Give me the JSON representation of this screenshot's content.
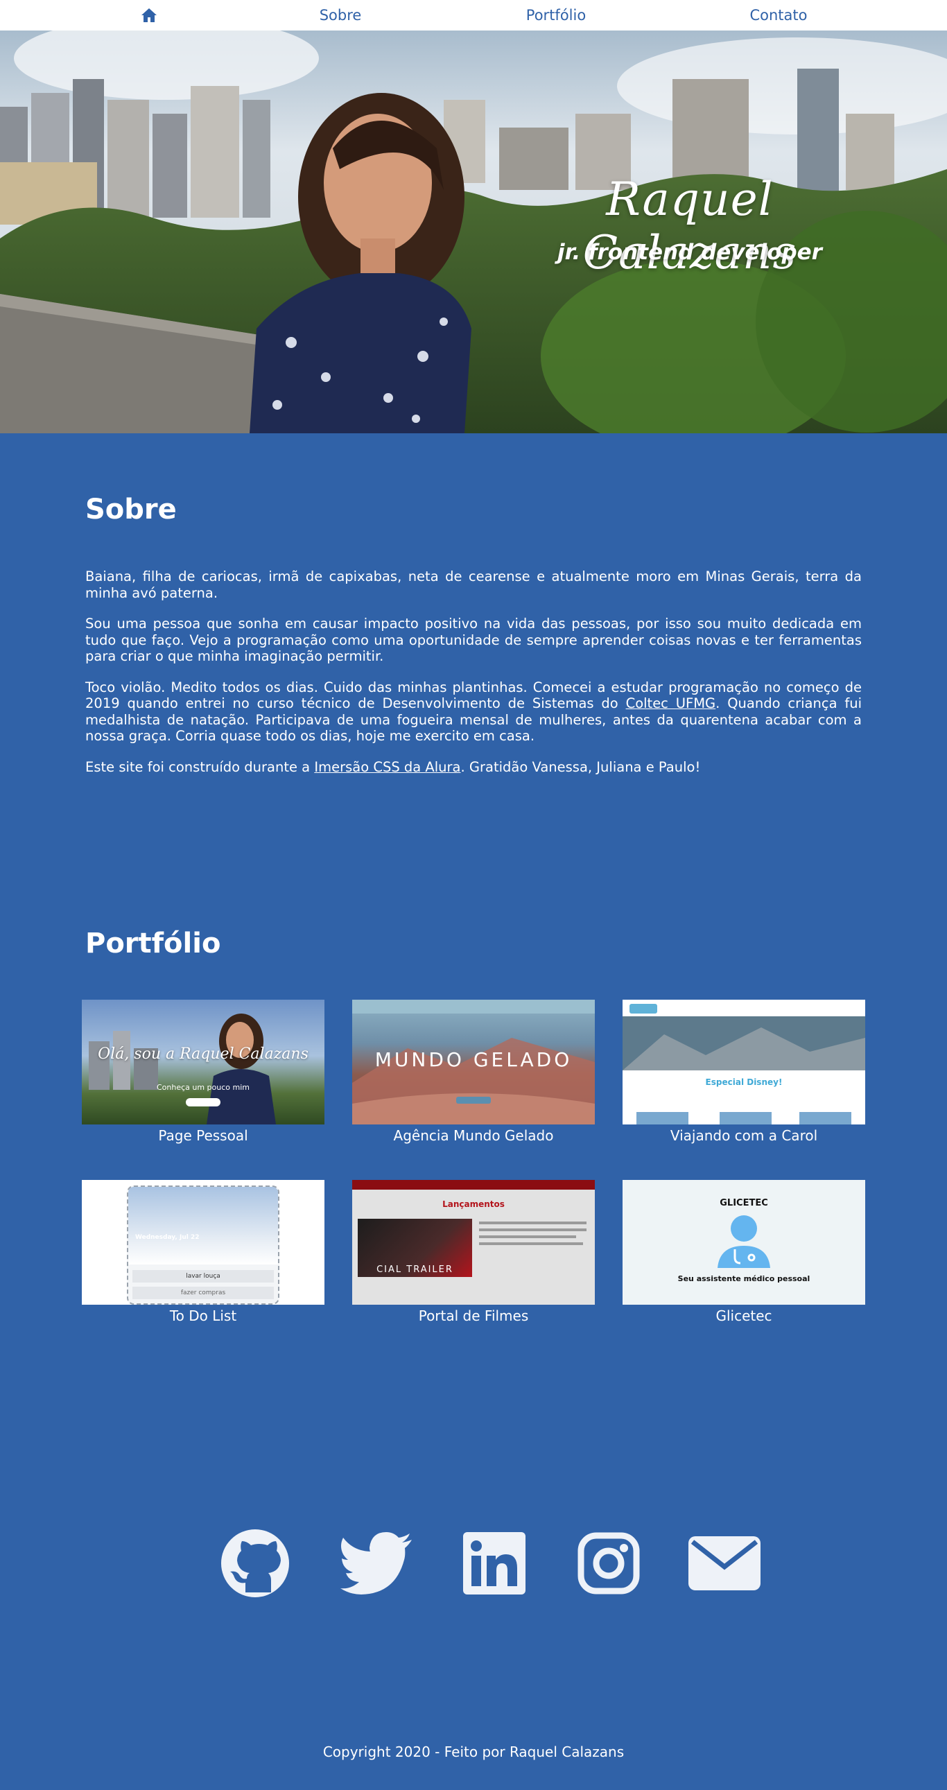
{
  "nav": {
    "home_icon": "home-icon",
    "items": [
      {
        "label": "Sobre"
      },
      {
        "label": "Portfólio"
      },
      {
        "label": "Contato"
      }
    ]
  },
  "hero": {
    "name": "Raquel Calazans",
    "role": "jr. frontend developer"
  },
  "sobre": {
    "title": "Sobre",
    "p1": "Baiana, filha de cariocas, irmã de capixabas, neta de cearense e atualmente moro em Minas Gerais, terra da minha avó paterna.",
    "p2": "Sou uma pessoa que sonha em causar impacto positivo na vida das pessoas, por isso sou muito dedicada em tudo que faço. Vejo a programação como uma oportunidade de sempre aprender coisas novas e ter ferramentas para criar o que minha imaginação permitir.",
    "p3_before": "Toco violão. Medito todos os dias. Cuido das minhas plantinhas. Comecei a estudar programação no começo de 2019 quando entrei no curso técnico de Desenvolvimento de Sistemas do ",
    "p3_link": "Coltec UFMG",
    "p3_after": ". Quando criança fui medalhista de natação. Participava de uma fogueira mensal de mulheres, antes da quarentena acabar com a nossa graça. Corria quase todo os dias, hoje me exercito em casa.",
    "p4_before": "Este site foi construído durante a ",
    "p4_link": "Imersão CSS da Alura",
    "p4_after": ". Gratidão Vanessa, Juliana e Paulo!"
  },
  "portfolio": {
    "title": "Portfólio",
    "projects": [
      {
        "label": "Page Pessoal",
        "thumb_text": "Olá, sou a Raquel Calazans",
        "thumb_sub": "Conheça um pouco mim"
      },
      {
        "label": "Agência Mundo Gelado",
        "thumb_text": "MUNDO GELADO"
      },
      {
        "label": "Viajando com a Carol",
        "thumb_text": "Especial Disney!"
      },
      {
        "label": "To Do List",
        "thumb_text": "Wednesday, Jul 22",
        "thumb_items": [
          "lavar louça",
          "fazer compras"
        ]
      },
      {
        "label": "Portal de Filmes",
        "thumb_text": "Lançamentos",
        "thumb_sub": "CIAL TRAILER"
      },
      {
        "label": "Glicetec",
        "thumb_text": "GLICETEC",
        "thumb_sub": "Seu assistente médico pessoal"
      }
    ]
  },
  "social": {
    "icons": [
      "github-icon",
      "twitter-icon",
      "linkedin-icon",
      "instagram-icon",
      "email-icon"
    ]
  },
  "footer": {
    "text": "Copyright 2020 - Feito por Raquel Calazans"
  },
  "colors": {
    "background": "#3062a8",
    "nav_background": "#ffffff",
    "nav_text": "#3062a8",
    "text": "#ffffff",
    "icon": "#eef2f8"
  }
}
